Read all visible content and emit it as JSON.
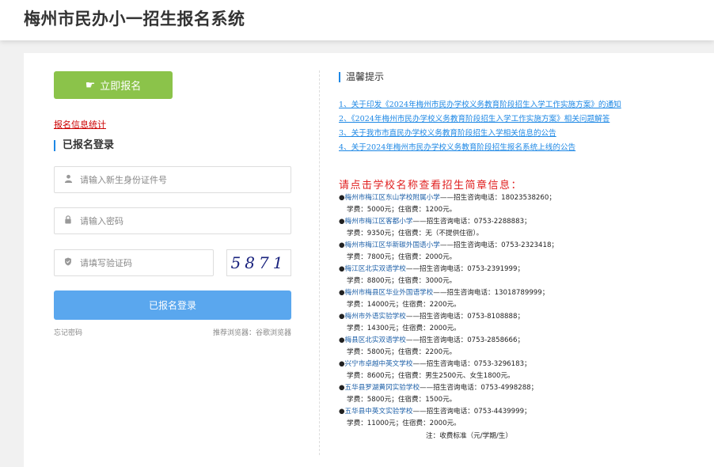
{
  "header": {
    "title": "梅州市民办小一招生报名系统"
  },
  "left": {
    "apply_button": "立即报名",
    "stat_link": "报名信息统计",
    "login_title": "已报名登录",
    "id_placeholder": "请输入新生身份证件号",
    "password_placeholder": "请输入密码",
    "captcha_placeholder": "请填写验证码",
    "captcha_code": "5871",
    "login_button": "已报名登录",
    "forgot": "忘记密码",
    "browser_tip": "推荐浏览器：谷歌浏览器"
  },
  "right": {
    "tips_title": "温馨提示",
    "notices": [
      "1、关于印发《2024年梅州市民办学校义务教育阶段招生入学工作实施方案》的通知",
      "2、《2024年梅州市民办学校义务教育阶段招生入学工作实施方案》相关问题解答",
      "3、关于我市市直民办学校义务教育阶段招生入学相关信息的公告",
      "4、关于2024年梅州市民办学校义务教育阶段招生报名系统上线的公告"
    ],
    "school_heading": "请点击学校名称查看招生简章信息：",
    "schools": [
      {
        "name": "梅州市梅江区东山学校附属小学",
        "contact": "——招生咨询电话：18023538260；",
        "fees": "学费：5000元；住宿费：1200元。"
      },
      {
        "name": "梅州市梅江区客都小学",
        "contact": "——招生咨询电话：0753-2288883；",
        "fees": "学费：9350元；住宿费：无（不提供住宿）。"
      },
      {
        "name": "梅州市梅江区华新碳外国语小学",
        "contact": "——招生咨询电话：0753-2323418；",
        "fees": "学费：7800元；住宿费：2000元。"
      },
      {
        "name": "梅江区北实双语学校",
        "contact": "——招生咨询电话：0753-2391999；",
        "fees": "学费：8800元；住宿费：3000元。"
      },
      {
        "name": "梅州市梅县区华业外国语学校",
        "contact": "——招生咨询电话：13018789999；",
        "fees": "学费：14000元；住宿费：2200元。"
      },
      {
        "name": "梅州市外语实验学校",
        "contact": "——招生咨询电话：0753-8108888；",
        "fees": "学费：14300元；住宿费：2000元。"
      },
      {
        "name": "梅县区北实双语学校",
        "contact": "——招生咨询电话：0753-2858666；",
        "fees": "学费：5800元；住宿费：2200元。"
      },
      {
        "name": "兴宁市卓越中英文学校",
        "contact": "——招生咨询电话：0753-3296183；",
        "fees": "学费：8600元；住宿费：男生2500元、女生1800元。"
      },
      {
        "name": "五华县罗湖黄冈实验学校",
        "contact": "——招生咨询电话：0753-4998288；",
        "fees": "学费：5800元；住宿费：1500元。"
      },
      {
        "name": "五华县中英文实验学校",
        "contact": "——招生咨询电话：0753-4439999；",
        "fees": "学费：11000元；住宿费：2000元。"
      }
    ],
    "note": "注：收费标准（元/学期/生）"
  }
}
